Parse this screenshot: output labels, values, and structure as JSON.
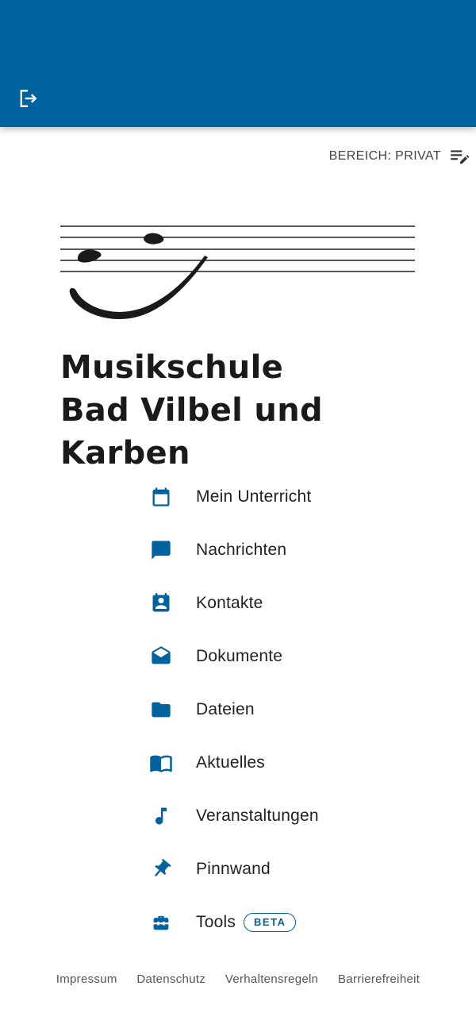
{
  "header": {
    "logout_icon": "logout-icon",
    "background_color": "#00629e"
  },
  "area": {
    "label": "BEREICH: PRIVAT",
    "icon": "edit-list-icon"
  },
  "school": {
    "name_line1": "Musikschule",
    "name_line2": "Bad Vilbel und Karben"
  },
  "menu": {
    "items": [
      {
        "label": "Mein Unterricht",
        "icon": "calendar-icon"
      },
      {
        "label": "Nachrichten",
        "icon": "message-icon"
      },
      {
        "label": "Kontakte",
        "icon": "contacts-icon"
      },
      {
        "label": "Dokumente",
        "icon": "open-mail-icon"
      },
      {
        "label": "Dateien",
        "icon": "folder-icon"
      },
      {
        "label": "Aktuelles",
        "icon": "book-icon"
      },
      {
        "label": "Veranstaltungen",
        "icon": "music-note-icon"
      },
      {
        "label": "Pinnwand",
        "icon": "pin-icon"
      },
      {
        "label": "Tools",
        "icon": "toolbox-icon",
        "badge": "BETA"
      }
    ],
    "icon_color": "#00629e"
  },
  "footer": {
    "links": [
      "Impressum",
      "Datenschutz",
      "Verhaltensregeln",
      "Barrierefreiheit"
    ]
  }
}
